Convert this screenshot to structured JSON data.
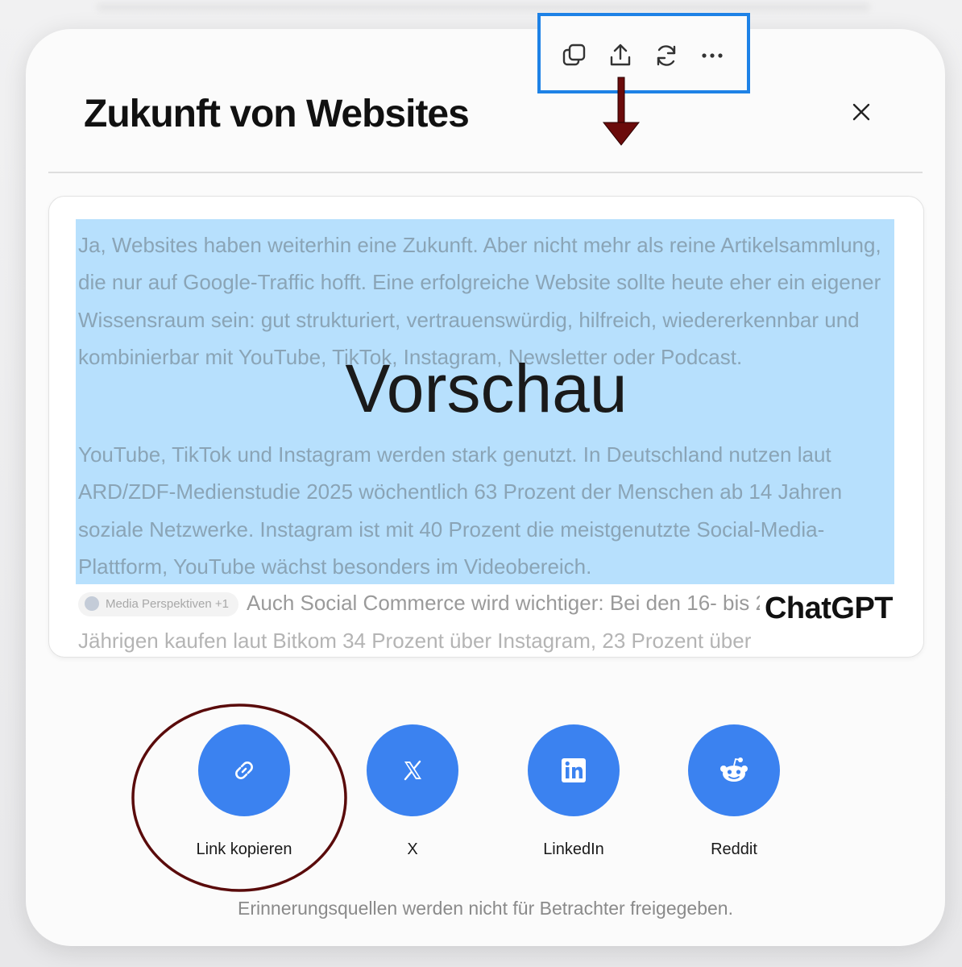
{
  "dialog": {
    "title": "Zukunft von Websites"
  },
  "toolbar": {
    "icons": [
      "copy-icon",
      "share-upload-icon",
      "refresh-icon",
      "more-icon"
    ]
  },
  "preview": {
    "paragraph1": "Ja, Websites haben weiterhin eine Zukunft. Aber nicht mehr als reine Artikelsammlung, die nur auf Google-Traffic hofft. Eine erfolgreiche Website sollte heute eher ein eigener Wissensraum sein: gut strukturiert, vertrauenswürdig, hilfreich, wiedererkennbar und kombinierbar mit YouTube, TikTok, Instagram, Newsletter oder Podcast.",
    "paragraph2": "YouTube, TikTok und Instagram werden stark genutzt. In Deutschland nutzen laut ARD/ZDF-Medienstudie 2025 wöchentlich 63 Prozent der Menschen ab 14 Jahren soziale Netzwerke. Instagram ist mit 40 Prozent die meistgenutzte Social-Media-Plattform, YouTube wächst besonders im Videobereich.",
    "source_chip": "Media Perspektiven",
    "source_more": "+1",
    "line3": "Auch Social Commerce wird wichtiger: Bei den 16- bis 29-",
    "line4": "Jährigen kaufen laut Bitkom 34 Prozent über Instagram, 23 Prozent über",
    "overlay_label": "Vorschau",
    "brand": "ChatGPT"
  },
  "share": {
    "items": [
      {
        "label": "Link kopieren",
        "icon": "link-icon"
      },
      {
        "label": "X",
        "icon": "x-logo-icon"
      },
      {
        "label": "LinkedIn",
        "icon": "linkedin-icon"
      },
      {
        "label": "Reddit",
        "icon": "reddit-icon"
      }
    ]
  },
  "footnote": "Erinnerungsquellen werden nicht für Betrachter freigegeben.",
  "colors": {
    "accent_blue": "#3b82f0",
    "annotation_box": "#1e82e6",
    "annotation_arrow": "#6b0b0b",
    "highlight": "#b7e0fd"
  }
}
